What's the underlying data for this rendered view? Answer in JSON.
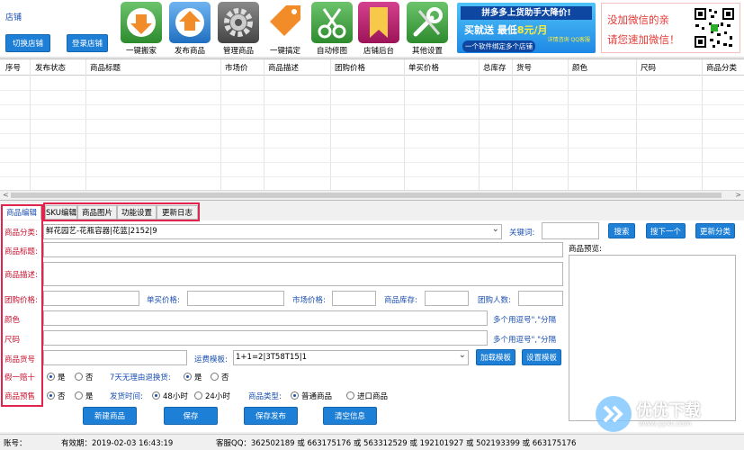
{
  "toolbar": {
    "shop_label": "店铺",
    "switch_shop": "切换店铺",
    "login_shop": "登录店铺",
    "tools": [
      {
        "label": "一键搬家",
        "color": "#3a9b3a",
        "icon": "download-icon"
      },
      {
        "label": "发布商品",
        "color": "#2f83d6",
        "icon": "upload-icon"
      },
      {
        "label": "管理商品",
        "color": "#555555",
        "icon": "gear-icon"
      },
      {
        "label": "一键搞定",
        "color": "#f28c28",
        "icon": "tag-icon"
      },
      {
        "label": "自动修图",
        "color": "#3a9b3a",
        "icon": "scissors-icon"
      },
      {
        "label": "店铺后台",
        "color": "#c2185b",
        "icon": "bookmark-icon"
      },
      {
        "label": "其他设置",
        "color": "#3a9b3a",
        "icon": "wrench-icon"
      }
    ]
  },
  "banner1": {
    "title": "拼多多上货助手大降价!",
    "main_a": "买就送",
    "main_b": "最低",
    "price": "8元/月",
    "sub": "一个软件绑定多个店铺",
    "qq": "详情咨询 QQ客服"
  },
  "banner2": {
    "line1": "没加微信的亲",
    "line2": "请您速加微信！"
  },
  "grid": {
    "columns": [
      "序号",
      "发布状态",
      "商品标题",
      "市场价",
      "商品描述",
      "团购价格",
      "单买价格",
      "总库存",
      "货号",
      "颜色",
      "尺码",
      "商品分类"
    ]
  },
  "tabs": [
    "商品编辑",
    "SKU编辑",
    "商品图片",
    "功能设置",
    "更新日志"
  ],
  "form": {
    "category_label": "商品分类:",
    "category_value": "鲜花园艺-花瓶容器|花篮|2152|9",
    "keyword_label": "关键词:",
    "search_btn": "搜索",
    "next_btn": "搜下一个",
    "update_btn": "更新分类",
    "title_label": "商品标题:",
    "preview_label": "商品预览:",
    "desc_label": "商品描述:",
    "group_price_label": "团购价格:",
    "single_price_label": "单买价格:",
    "market_price_label": "市场价格:",
    "stock_label": "商品库存:",
    "group_people_label": "团购人数:",
    "color_label": "颜色",
    "color_hint": "多个用逗号\",\"分隔",
    "size_label": "尺码",
    "size_hint": "多个用逗号\",\"分隔",
    "sku_label": "商品货号",
    "shipping_label": "运费模板:",
    "shipping_value": "1+1=2|3T58T15|1",
    "load_template": "加载模板",
    "set_template": "设置模板",
    "fake_label": "假一赔十",
    "yes": "是",
    "no": "否",
    "return_label": "7天无理由退换货:",
    "overseas_label": "商品预售",
    "ship_time_label": "发货时间:",
    "ship_48": "48小时",
    "ship_24": "24小时",
    "goods_type_label": "商品类型:",
    "goods_normal": "普通商品",
    "goods_import": "进口商品"
  },
  "buttons": {
    "new": "新建商品",
    "save": "保存",
    "save_publish": "保存发布",
    "clear": "清空信息"
  },
  "status": {
    "account": "账号：",
    "valid": "有效期：2019-02-03 16:43:19",
    "qq": "客服QQ：362502189 或 663175176 或 563312529 或 192101927 或 502193399 或 663175176"
  },
  "watermark": {
    "name": "优优下载",
    "url": "www.yyxt.com"
  }
}
